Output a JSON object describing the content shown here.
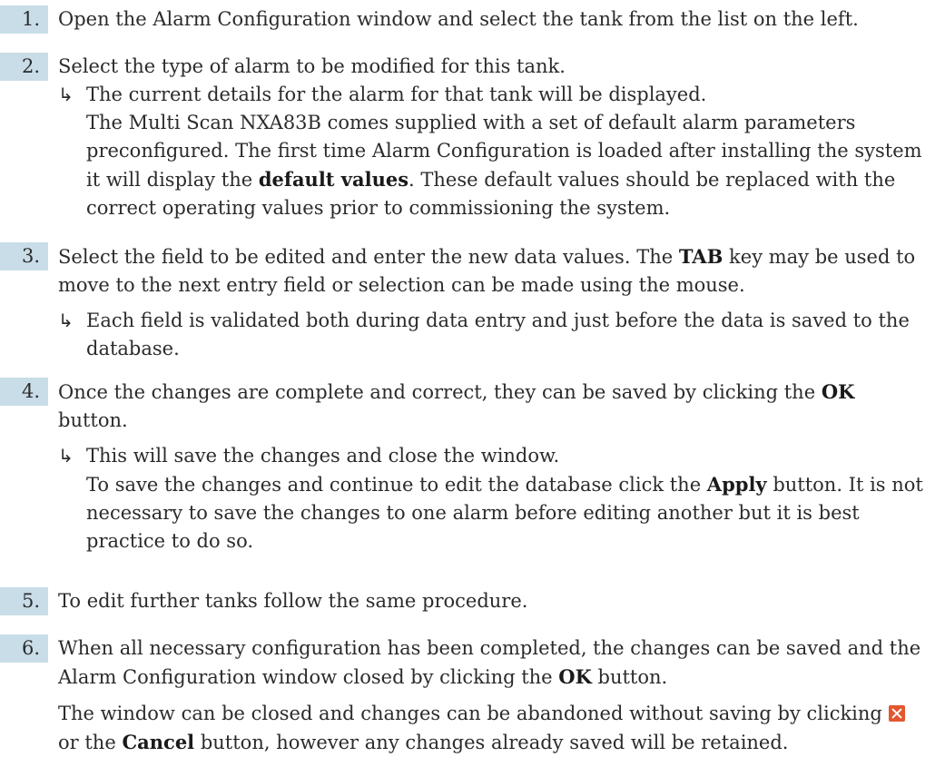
{
  "steps": [
    {
      "number": "1.",
      "text": "Open the Alarm Configuration window and select the tank from the list on the left."
    },
    {
      "number": "2.",
      "text": "Select the type of alarm to be modified for this tank.",
      "result": {
        "line1": "The current details for the alarm for that tank will be displayed.",
        "p_a": "The Multi Scan NXA83B comes supplied with a set of default alarm parameters preconfigured. The first time Alarm Configuration is loaded after installing the system it will display the ",
        "p_bold": "default values",
        "p_b": ". These default values should be replaced with the correct operating values prior to commissioning the system."
      }
    },
    {
      "number": "3.",
      "text_a": "Select the field to be edited and enter the new data values. The ",
      "text_bold": "TAB",
      "text_b": " key may be used to move to the next entry field or selection can be made using the mouse.",
      "result": {
        "line1": "Each field is validated both during data entry and just before the data is saved to the database."
      }
    },
    {
      "number": "4.",
      "text_a": "Once the changes are complete and correct, they can be saved by clicking the ",
      "text_bold": "OK",
      "text_b": " button.",
      "result": {
        "line1": "This will save the changes and close the window.",
        "p_a": "To save the changes and continue to edit the database click the ",
        "p_bold": "Apply",
        "p_b": " button. It is not necessary to save the changes to one alarm before editing another but it is best practice to do so."
      }
    },
    {
      "number": "5.",
      "text": "To edit further tanks follow the same procedure."
    },
    {
      "number": "6.",
      "text_a": "When all necessary configuration has been completed, the changes can be saved and the Alarm Configuration window closed by clicking the ",
      "text_bold": "OK",
      "text_b": " button.",
      "note_a": "The window can be closed and changes can be abandoned without saving by clicking ",
      "note_b": " or the ",
      "note_bold": "Cancel",
      "note_c": " button, however any changes already saved will be retained."
    }
  ],
  "arrow_glyph": "↳",
  "icons": {
    "close": "close-x-icon"
  }
}
